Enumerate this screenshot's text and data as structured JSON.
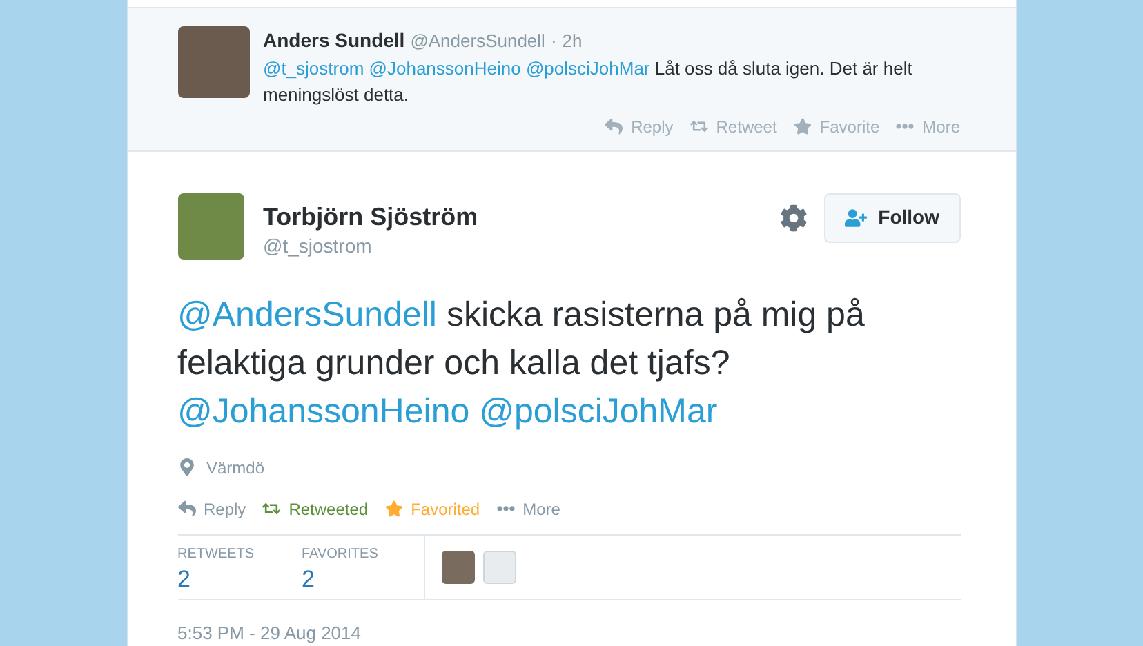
{
  "reply_tweet": {
    "name": "Anders Sundell",
    "handle": "@AndersSundell",
    "separator": "·",
    "time": "2h",
    "text": [
      {
        "kind": "mention",
        "text": "@t_sjostrom"
      },
      {
        "kind": "mention",
        "text": "@JohanssonHeino"
      },
      {
        "kind": "mention",
        "text": "@polsciJohMar"
      },
      {
        "kind": "text",
        "text": "Låt oss då sluta igen. Det är helt meningslöst detta."
      }
    ],
    "actions": [
      {
        "kind": "reply",
        "label": "Reply"
      },
      {
        "kind": "retweet",
        "label": "Retweet"
      },
      {
        "kind": "favorite",
        "label": "Favorite"
      },
      {
        "kind": "more",
        "label": "More"
      }
    ]
  },
  "main_tweet": {
    "name": "Torbjörn Sjöström",
    "handle": "@t_sjostrom",
    "follow_label": "Follow",
    "text": [
      {
        "kind": "mention",
        "text": "@AndersSundell"
      },
      {
        "kind": "text",
        "text": "skicka rasisterna på mig på felaktiga grunder och kalla det tjafs?"
      },
      {
        "kind": "mention",
        "text": "@JohanssonHeino"
      },
      {
        "kind": "mention",
        "text": "@polsciJohMar"
      }
    ],
    "location": "Värmdö",
    "actions": [
      {
        "kind": "reply",
        "label": "Reply"
      },
      {
        "kind": "retweet",
        "label": "Retweeted",
        "on": true
      },
      {
        "kind": "favorite",
        "label": "Favorited",
        "on": true
      },
      {
        "kind": "more",
        "label": "More"
      }
    ],
    "stats": [
      {
        "label": "RETWEETS",
        "value": "2"
      },
      {
        "label": "FAVORITES",
        "value": "2"
      }
    ],
    "timestamp": "5:53 PM - 29 Aug 2014"
  }
}
